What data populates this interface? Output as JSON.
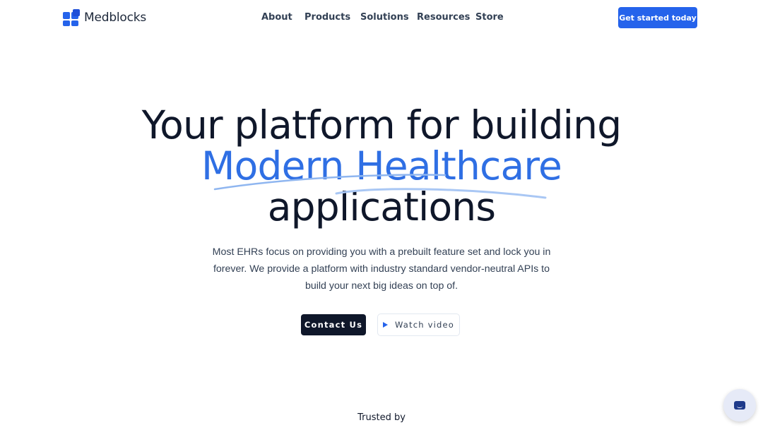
{
  "brand": {
    "name": "Medblocks",
    "logo_icon": "blocks-logo-icon",
    "accent": "#2563eb"
  },
  "nav": {
    "items": [
      {
        "label": "About"
      },
      {
        "label": "Products"
      },
      {
        "label": "Solutions"
      },
      {
        "label": "Resources"
      },
      {
        "label": "Store"
      }
    ],
    "cta_label": "Get started today"
  },
  "hero": {
    "line1": "Your platform for building",
    "line2": "Modern Healthcare",
    "line3": "applications",
    "highlight_color": "#2f6fe4",
    "description": "Most EHRs focus on providing you with a prebuilt feature set and lock you in forever. We provide a platform with industry standard vendor-neutral APIs to build your next big ideas on top of.",
    "contact_label": "Contact Us",
    "video_label": "Watch video",
    "video_icon": "play-icon"
  },
  "trusted": {
    "label": "Trusted by"
  },
  "chat": {
    "icon": "chat-icon"
  }
}
